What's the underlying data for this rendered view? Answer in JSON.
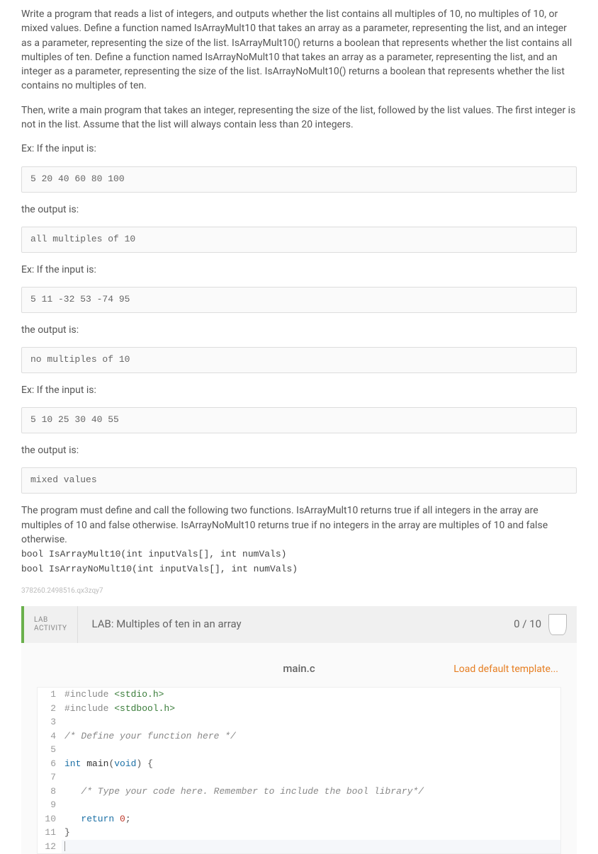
{
  "intro": {
    "p1": "Write a program that reads a list of integers, and outputs whether the list contains all multiples of 10, no multiples of 10, or mixed values. Define a function named IsArrayMult10 that takes an array as a parameter, representing the list, and an integer as a parameter, representing the size of the list. IsArrayMult10() returns a boolean that represents whether the list contains all multiples of ten. Define a function named IsArrayNoMult10 that takes an array as a parameter, representing the list, and an integer as a parameter, representing the size of the list. IsArrayNoMult10() returns a boolean that represents whether the list contains no multiples of ten.",
    "p2": "Then, write a main program that takes an integer, representing the size of the list, followed by the list values. The first integer is not in the list. Assume that the list will always contain less than 20 integers."
  },
  "examples": {
    "lead_in": "Ex: If the input is:",
    "output_lead": "the output is:",
    "ex1_in": "5 20 40 60 80 100",
    "ex1_out": "all multiples of 10",
    "ex2_in": "5 11 -32 53 -74 95",
    "ex2_out": "no multiples of 10",
    "ex3_in": "5 10 25 30 40 55",
    "ex3_out": "mixed values"
  },
  "spec": {
    "desc": "The program must define and call the following two functions. IsArrayMult10 returns true if all integers in the array are multiples of 10 and false otherwise. IsArrayNoMult10 returns true if no integers in the array are multiples of 10 and false otherwise.",
    "sig1": "bool IsArrayMult10(int inputVals[], int numVals)",
    "sig2": "bool IsArrayNoMult10(int inputVals[], int numVals)"
  },
  "watermark": "378260.2498516.qx3zqy7",
  "lab": {
    "badge_line1": "LAB",
    "badge_line2": "ACTIVITY",
    "title": "LAB: Multiples of ten in an array",
    "score": "0 / 10"
  },
  "editor": {
    "filename": "main.c",
    "load_template": "Load default template...",
    "lines": [
      {
        "n": "1",
        "tokens": [
          [
            "pre",
            "#include "
          ],
          [
            "inc",
            "<stdio.h>"
          ]
        ]
      },
      {
        "n": "2",
        "tokens": [
          [
            "pre",
            "#include "
          ],
          [
            "inc",
            "<stdbool.h>"
          ]
        ]
      },
      {
        "n": "3",
        "tokens": []
      },
      {
        "n": "4",
        "tokens": [
          [
            "comm",
            "/* Define your function here */"
          ]
        ]
      },
      {
        "n": "5",
        "tokens": []
      },
      {
        "n": "6",
        "tokens": [
          [
            "type",
            "int "
          ],
          [
            "id",
            "main"
          ],
          [
            "par",
            "("
          ],
          [
            "type",
            "void"
          ],
          [
            "par",
            ") {"
          ]
        ]
      },
      {
        "n": "7",
        "tokens": []
      },
      {
        "n": "8",
        "tokens": [
          [
            "id",
            "   "
          ],
          [
            "comm",
            "/* Type your code here. Remember to include the bool library*/"
          ]
        ]
      },
      {
        "n": "9",
        "tokens": []
      },
      {
        "n": "10",
        "tokens": [
          [
            "id",
            "   "
          ],
          [
            "kw",
            "return "
          ],
          [
            "num",
            "0"
          ],
          [
            "par",
            ";"
          ]
        ]
      },
      {
        "n": "11",
        "tokens": [
          [
            "par",
            "}"
          ]
        ]
      },
      {
        "n": "12",
        "tokens": [],
        "cursor": true
      }
    ]
  }
}
